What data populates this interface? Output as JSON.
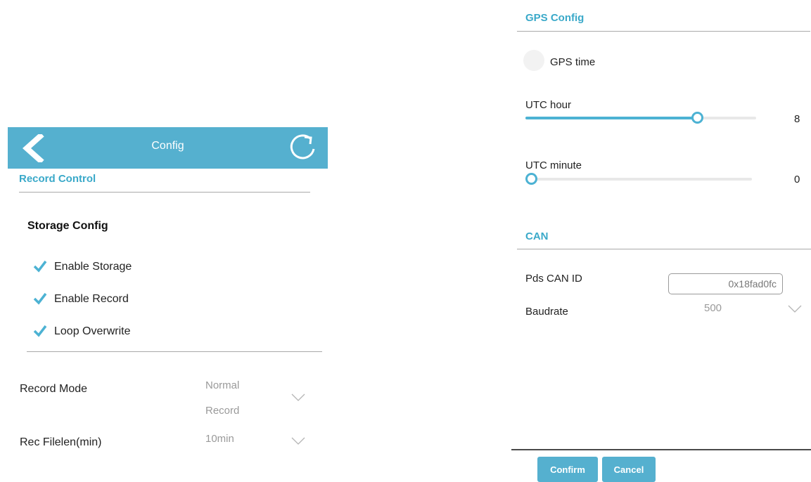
{
  "header": {
    "title": "Config",
    "back_icon": "back-chevron-icon",
    "refresh_icon": "refresh-icon",
    "color": "#55b0cf"
  },
  "record_control": {
    "section_title": "Record Control",
    "storage_config": {
      "title": "Storage Config",
      "options": [
        {
          "label": "Enable Storage",
          "checked": true
        },
        {
          "label": "Enable Record",
          "checked": true
        },
        {
          "label": "Loop Overwrite",
          "checked": true
        }
      ]
    },
    "record_mode": {
      "label": "Record Mode",
      "value_line1": "Normal",
      "value_line2": "Record"
    },
    "rec_filelen": {
      "label": "Rec Filelen(min)",
      "value": "10min"
    }
  },
  "gps_config": {
    "section_title": "GPS Config",
    "gps_time": {
      "label": "GPS time",
      "enabled": false
    },
    "utc_hour": {
      "label": "UTC hour",
      "value": "8",
      "min": 0,
      "max": 12
    },
    "utc_minute": {
      "label": "UTC minute",
      "value": "0",
      "min": 0,
      "max": 59
    }
  },
  "can": {
    "section_title": "CAN",
    "pds_can_id": {
      "label": "Pds CAN ID",
      "value": "0x18fad0fc"
    },
    "baudrate": {
      "label": "Baudrate",
      "value": "500"
    }
  },
  "footer": {
    "confirm_label": "Confirm",
    "cancel_label": "Cancel"
  },
  "colors": {
    "accent": "#55b0cf",
    "section_title": "#3aa9c9"
  }
}
